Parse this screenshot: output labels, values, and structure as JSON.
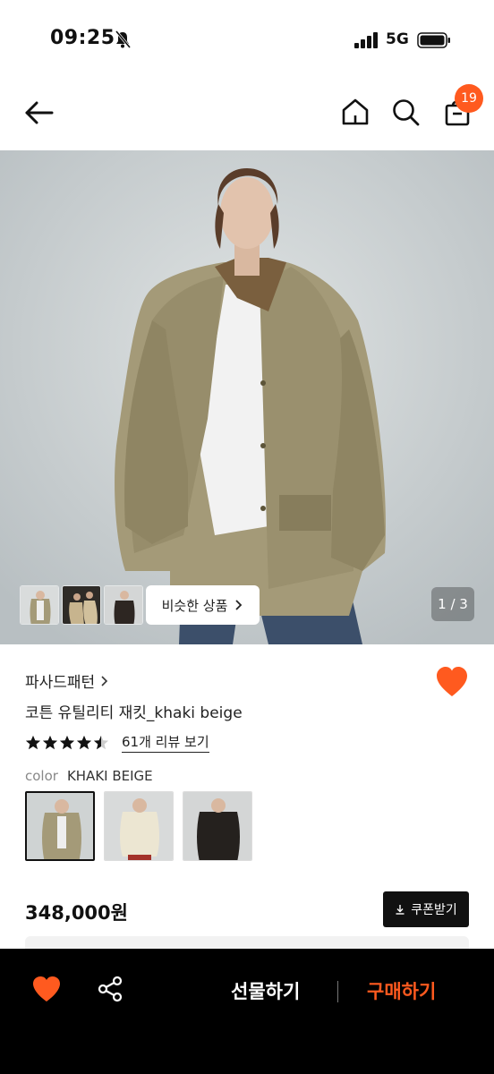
{
  "status_bar": {
    "time": "09:25",
    "network": "5G"
  },
  "nav": {
    "cart_badge": "19"
  },
  "gallery": {
    "similar_label": "비슷한 상품",
    "counter": "1 / 3"
  },
  "product": {
    "brand": "파사드패턴",
    "name": "코튼 유틸리티 재킷_khaki beige",
    "rating": 4.5,
    "review_link": "61개 리뷰 보기",
    "color_label": "color",
    "color_value": "KHAKI BEIGE",
    "price": "348,000원",
    "coupon_label": "쿠폰받기"
  },
  "bottom_bar": {
    "gift_label": "선물하기",
    "buy_label": "구매하기"
  },
  "colors": {
    "accent": "#ff5a1f",
    "bottom_bar_bg": "#000000"
  },
  "icons": [
    "back-arrow-icon",
    "home-icon",
    "search-icon",
    "shopping-bag-icon",
    "heart-icon",
    "share-icon",
    "download-icon",
    "star-icon",
    "chevron-right-icon",
    "bell-off-icon",
    "signal-icon",
    "battery-icon"
  ]
}
